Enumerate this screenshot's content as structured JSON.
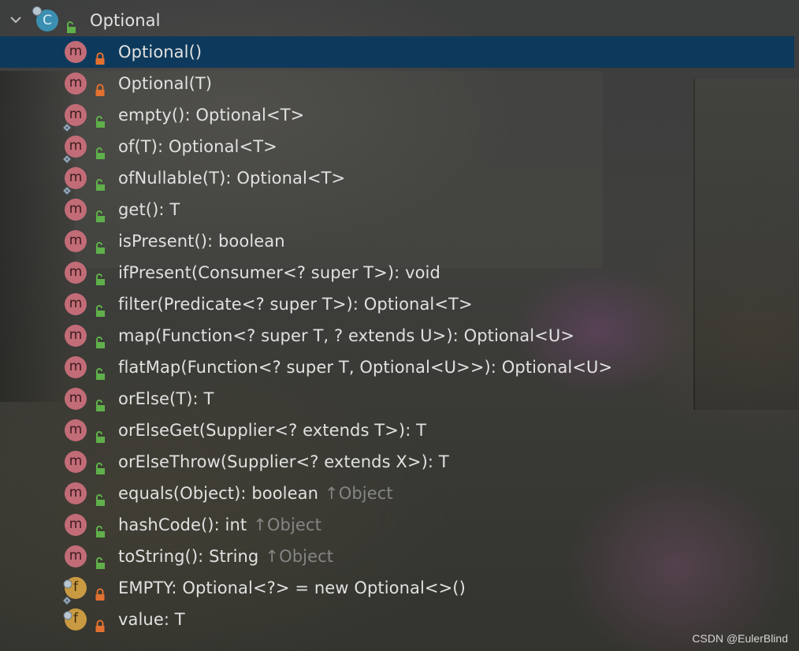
{
  "colors": {
    "selection": "#0d3a5c",
    "method_icon": "#c26c78",
    "field_icon": "#c99a42",
    "class_icon": "#3b8fb1",
    "public_lock": "#5fb04a",
    "private_lock": "#e2712f",
    "inherited_text": "#858585"
  },
  "tree": {
    "root": {
      "icon": "class-icon",
      "icon_letter": "C",
      "access": "public",
      "label": "Optional",
      "expanded": true
    },
    "members": [
      {
        "kind": "method",
        "letter": "m",
        "access": "private",
        "static": false,
        "label": "Optional()",
        "inherited": "",
        "selected": true
      },
      {
        "kind": "method",
        "letter": "m",
        "access": "private",
        "static": false,
        "label": "Optional(T)",
        "inherited": "",
        "selected": false
      },
      {
        "kind": "method",
        "letter": "m",
        "access": "public",
        "static": true,
        "label": "empty(): Optional<T>",
        "inherited": "",
        "selected": false
      },
      {
        "kind": "method",
        "letter": "m",
        "access": "public",
        "static": true,
        "label": "of(T): Optional<T>",
        "inherited": "",
        "selected": false
      },
      {
        "kind": "method",
        "letter": "m",
        "access": "public",
        "static": true,
        "label": "ofNullable(T): Optional<T>",
        "inherited": "",
        "selected": false
      },
      {
        "kind": "method",
        "letter": "m",
        "access": "public",
        "static": false,
        "label": "get(): T",
        "inherited": "",
        "selected": false
      },
      {
        "kind": "method",
        "letter": "m",
        "access": "public",
        "static": false,
        "label": "isPresent(): boolean",
        "inherited": "",
        "selected": false
      },
      {
        "kind": "method",
        "letter": "m",
        "access": "public",
        "static": false,
        "label": "ifPresent(Consumer<? super T>): void",
        "inherited": "",
        "selected": false
      },
      {
        "kind": "method",
        "letter": "m",
        "access": "public",
        "static": false,
        "label": "filter(Predicate<? super T>): Optional<T>",
        "inherited": "",
        "selected": false
      },
      {
        "kind": "method",
        "letter": "m",
        "access": "public",
        "static": false,
        "label": "map(Function<? super T, ? extends U>): Optional<U>",
        "inherited": "",
        "selected": false
      },
      {
        "kind": "method",
        "letter": "m",
        "access": "public",
        "static": false,
        "label": "flatMap(Function<? super T, Optional<U>>): Optional<U>",
        "inherited": "",
        "selected": false
      },
      {
        "kind": "method",
        "letter": "m",
        "access": "public",
        "static": false,
        "label": "orElse(T): T",
        "inherited": "",
        "selected": false
      },
      {
        "kind": "method",
        "letter": "m",
        "access": "public",
        "static": false,
        "label": "orElseGet(Supplier<? extends T>): T",
        "inherited": "",
        "selected": false
      },
      {
        "kind": "method",
        "letter": "m",
        "access": "public",
        "static": false,
        "label": "orElseThrow(Supplier<? extends X>): T",
        "inherited": "",
        "selected": false
      },
      {
        "kind": "method",
        "letter": "m",
        "access": "public",
        "static": false,
        "label": "equals(Object): boolean",
        "inherited": "↑Object",
        "selected": false
      },
      {
        "kind": "method",
        "letter": "m",
        "access": "public",
        "static": false,
        "label": "hashCode(): int",
        "inherited": "↑Object",
        "selected": false
      },
      {
        "kind": "method",
        "letter": "m",
        "access": "public",
        "static": false,
        "label": "toString(): String",
        "inherited": "↑Object",
        "selected": false
      },
      {
        "kind": "field",
        "letter": "f",
        "access": "private",
        "static": true,
        "label": "EMPTY: Optional<?> = new Optional<>()",
        "inherited": "",
        "selected": false
      },
      {
        "kind": "field",
        "letter": "f",
        "access": "private",
        "static": false,
        "label": "value: T",
        "inherited": "",
        "selected": false
      }
    ]
  },
  "watermark": "CSDN @EulerBlind"
}
